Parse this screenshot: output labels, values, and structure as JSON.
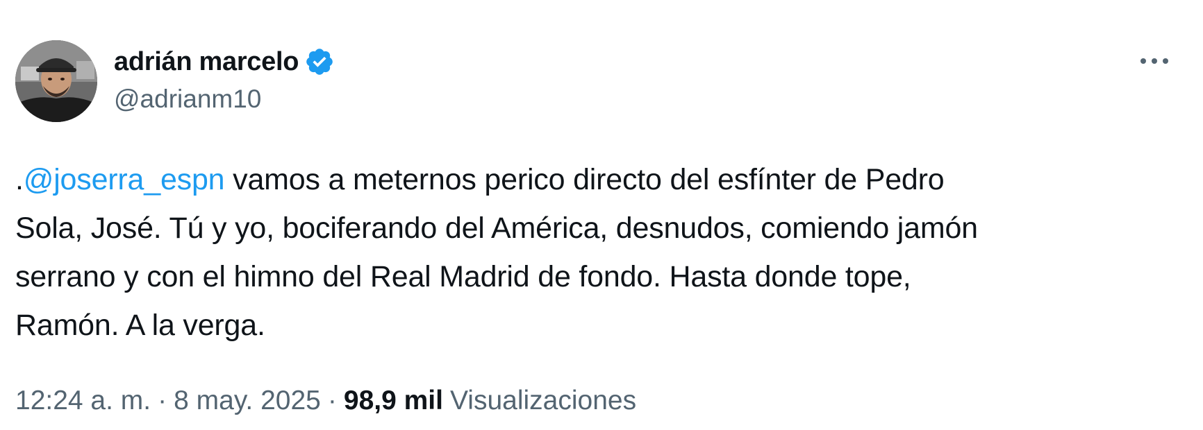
{
  "author": {
    "display_name": "adrián marcelo",
    "handle": "@adrianm10",
    "verified": true,
    "verified_color": "#1d9bf0"
  },
  "tweet": {
    "prefix": ".",
    "mention": "@joserra_espn",
    "line1_rest": " vamos a meternos perico directo del esfínter de Pedro",
    "line2": "Sola, José. Tú y yo, bociferando del América, desnudos, comiendo jamón",
    "line3": "serrano y con el himno del Real Madrid de fondo. Hasta donde tope,",
    "line4": "Ramón. A la verga."
  },
  "meta": {
    "time": "12:24 a. m.",
    "separator": "·",
    "date": "8 may. 2025",
    "views_count": "98,9 mil",
    "views_label": "Visualizaciones"
  },
  "icons": {
    "more": "more-horizontal-icon",
    "verified": "verified-badge-icon"
  },
  "colors": {
    "text": "#0f1419",
    "secondary": "#536471",
    "accent": "#1d9bf0"
  }
}
